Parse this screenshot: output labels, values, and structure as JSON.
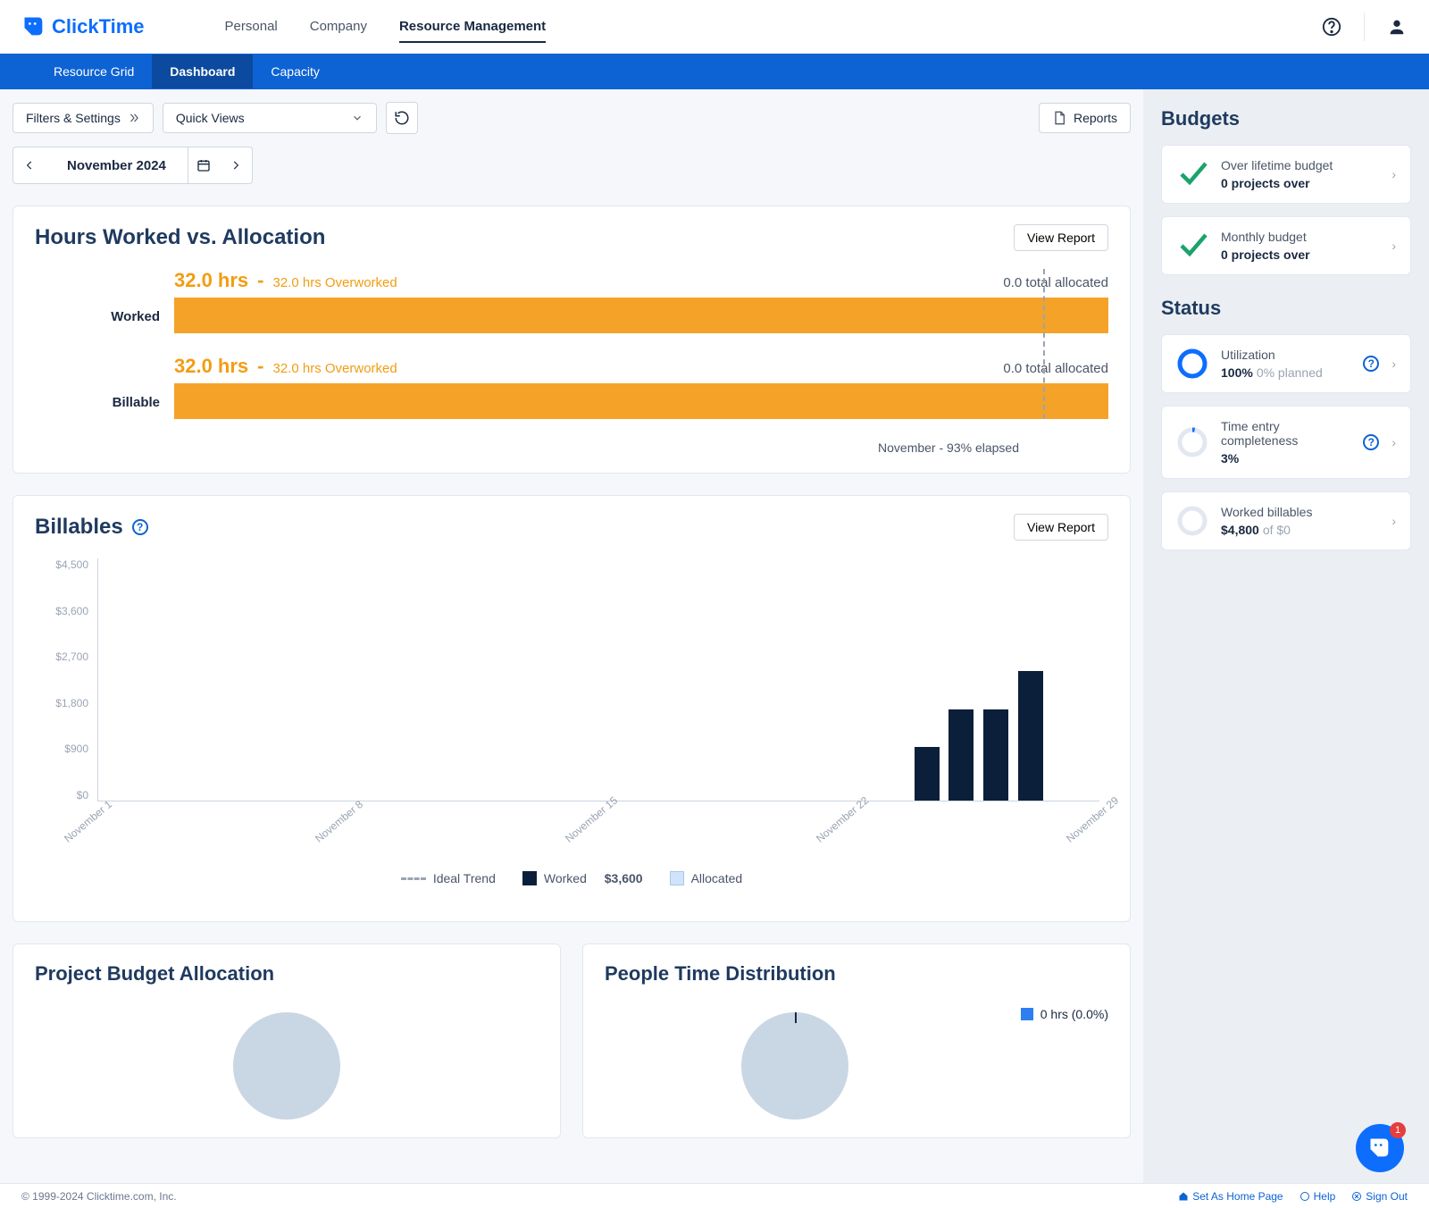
{
  "header": {
    "brand": "ClickTime",
    "nav": [
      "Personal",
      "Company",
      "Resource Management"
    ],
    "active_nav": 2
  },
  "subnav": {
    "items": [
      "Resource Grid",
      "Dashboard",
      "Capacity"
    ],
    "active": 1
  },
  "toolbar": {
    "filters": "Filters & Settings",
    "quick_views": "Quick Views",
    "reports": "Reports"
  },
  "date_nav": {
    "label": "November 2024"
  },
  "hours_card": {
    "title": "Hours Worked vs. Allocation",
    "view_report": "View Report",
    "rows": [
      {
        "label": "Worked",
        "hours": "32.0 hrs",
        "overworked": "32.0 hrs Overworked",
        "allocated": "0.0 total allocated"
      },
      {
        "label": "Billable",
        "hours": "32.0 hrs",
        "overworked": "32.0 hrs Overworked",
        "allocated": "0.0 total allocated"
      }
    ],
    "elapsed_note": "November - 93% elapsed"
  },
  "billables_card": {
    "title": "Billables",
    "view_report": "View Report",
    "legend": {
      "ideal": "Ideal Trend",
      "worked": "Worked",
      "worked_val": "$3,600",
      "allocated": "Allocated"
    }
  },
  "chart_data": {
    "type": "bar",
    "y_ticks": [
      "$4,500",
      "$3,600",
      "$2,700",
      "$1,800",
      "$900",
      "$0"
    ],
    "x_categories": [
      "November 1",
      "November 8",
      "November 15",
      "November 22",
      "November 29"
    ],
    "series": [
      {
        "name": "Worked",
        "values": [
          0,
          0,
          0,
          0,
          0,
          0,
          0,
          0,
          0,
          0,
          0,
          0,
          0,
          0,
          0,
          0,
          0,
          0,
          0,
          0,
          0,
          0,
          0,
          0,
          1000,
          1700,
          1700,
          2400,
          0,
          0
        ]
      }
    ],
    "ylim": [
      0,
      4500
    ],
    "ylabel": "",
    "xlabel": ""
  },
  "project_card": {
    "title": "Project Budget Allocation"
  },
  "people_card": {
    "title": "People Time Distribution",
    "legend_row": "0 hrs (0.0%)"
  },
  "sidebar": {
    "budgets_title": "Budgets",
    "lifetime": {
      "title": "Over lifetime budget",
      "sub": "0 projects over"
    },
    "monthly": {
      "title": "Monthly budget",
      "sub": "0 projects over"
    },
    "status_title": "Status",
    "utilization": {
      "title": "Utilization",
      "pct": "100%",
      "planned": "0% planned",
      "ring": 100
    },
    "completeness": {
      "title": "Time entry completeness",
      "pct": "3%",
      "ring": 3
    },
    "worked_billables": {
      "title": "Worked billables",
      "amount": "$4,800",
      "of": "of $0",
      "ring": 0
    }
  },
  "footer": {
    "copyright": "© 1999-2024 Clicktime.com, Inc.",
    "home": "Set As Home Page",
    "help": "Help",
    "signout": "Sign Out"
  },
  "chat": {
    "badge": "1"
  }
}
